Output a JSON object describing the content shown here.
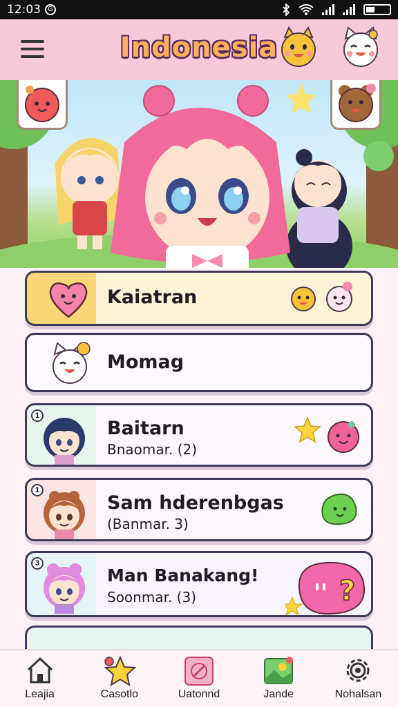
{
  "status_bar": {
    "time": "12:03",
    "notification_glyph": "G"
  },
  "header": {
    "title": "Indonesia",
    "menu_icon": "hamburger-menu-icon"
  },
  "cards": [
    {
      "title": "Kaiatran",
      "subtitle": ""
    },
    {
      "title": "Momag",
      "subtitle": ""
    },
    {
      "title": "Baitarn",
      "subtitle": "Bnaomar. (2)",
      "badge": "1"
    },
    {
      "title": "Sam hderenbgas",
      "subtitle": "(Banmar. 3)",
      "badge": "1"
    },
    {
      "title": "Man Banakang!",
      "subtitle": "Soonmar. (3)",
      "badge": "3"
    }
  ],
  "bottom_nav": [
    {
      "label": "Leajia",
      "icon": "home-icon"
    },
    {
      "label": "Casotlo",
      "icon": "star-icon"
    },
    {
      "label": "Uatonnd",
      "icon": "compass-icon"
    },
    {
      "label": "Jande",
      "icon": "photo-icon"
    },
    {
      "label": "Nohalsan",
      "icon": "settings-icon"
    }
  ],
  "colors": {
    "header_bg": "#f8c9d9",
    "title_fill": "#ffb05a",
    "highlight_card": "#fde8a3",
    "card_border": "#3e3a55"
  }
}
